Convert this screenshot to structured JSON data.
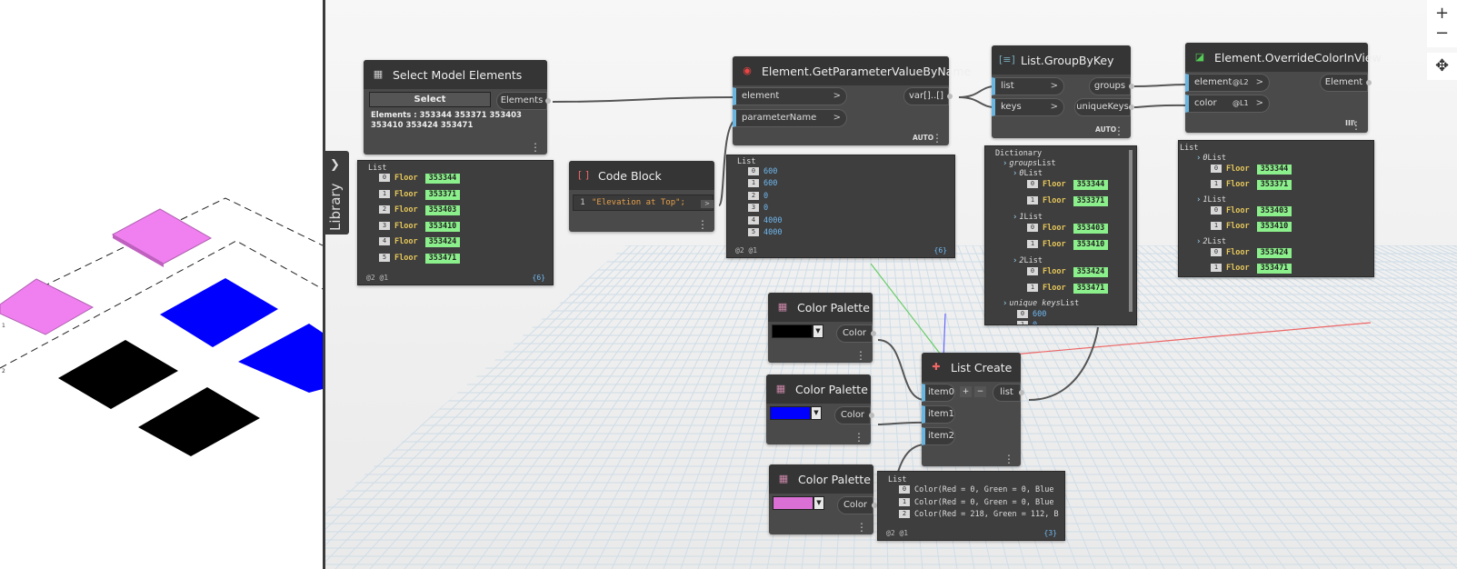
{
  "library": {
    "label": "Library"
  },
  "nodes": {
    "select_model": {
      "title": "Select Model Elements",
      "select_btn": "Select",
      "output": "Elements",
      "info_line1": "Elements : 353344 353371 353403",
      "info_line2": "353410 353424 353471"
    },
    "code_block": {
      "title": "Code Block",
      "line_no": "1",
      "code": "\"Elevation at Top\";"
    },
    "get_param": {
      "title": "Element.GetParameterValueByName",
      "in1": "element",
      "in2": "parameterName",
      "out": "var[]..[]",
      "mode": "AUTO"
    },
    "group_by_key": {
      "title": "List.GroupByKey",
      "in1": "list",
      "in2": "keys",
      "out1": "groups",
      "out2": "uniqueKeys",
      "mode": "AUTO"
    },
    "override": {
      "title": "Element.OverrideColorInView",
      "in1": "element",
      "in1_lace": "@L2",
      "in2": "color",
      "in2_lace": "@L1",
      "out": "Element",
      "lace_icon": "III\\"
    },
    "palette1": {
      "title": "Color Palette",
      "out": "Color",
      "color": "#000000"
    },
    "palette2": {
      "title": "Color Palette",
      "out": "Color",
      "color": "#0000ff"
    },
    "palette3": {
      "title": "Color Palette",
      "out": "Color",
      "color": "#da70d6"
    },
    "list_create": {
      "title": "List Create",
      "in1": "item0",
      "in2": "item1",
      "in3": "item2",
      "out": "list",
      "add": "+",
      "remove": "−"
    }
  },
  "previews": {
    "select_list": {
      "title": "List",
      "rows": [
        {
          "idx": "0",
          "kw": "Floor",
          "val": "353344"
        },
        {
          "idx": "1",
          "kw": "Floor",
          "val": "353371"
        },
        {
          "idx": "2",
          "kw": "Floor",
          "val": "353403"
        },
        {
          "idx": "3",
          "kw": "Floor",
          "val": "353410"
        },
        {
          "idx": "4",
          "kw": "Floor",
          "val": "353424"
        },
        {
          "idx": "5",
          "kw": "Floor",
          "val": "353471"
        }
      ],
      "foot_left": "@2 @1",
      "foot_right": "{6}"
    },
    "param_list": {
      "title": "List",
      "rows": [
        {
          "idx": "0",
          "val": "600"
        },
        {
          "idx": "1",
          "val": "600"
        },
        {
          "idx": "2",
          "val": "0"
        },
        {
          "idx": "3",
          "val": "0"
        },
        {
          "idx": "4",
          "val": "4000"
        },
        {
          "idx": "5",
          "val": "4000"
        }
      ],
      "foot_left": "@2 @1",
      "foot_right": "{6}"
    },
    "dict": {
      "title": "Dictionary",
      "groups_label": "groups",
      "list_word": "List",
      "g0": {
        "idx": "0",
        "rows": [
          {
            "idx": "0",
            "kw": "Floor",
            "val": "353344"
          },
          {
            "idx": "1",
            "kw": "Floor",
            "val": "353371"
          }
        ]
      },
      "g1": {
        "idx": "1",
        "rows": [
          {
            "idx": "0",
            "kw": "Floor",
            "val": "353403"
          },
          {
            "idx": "1",
            "kw": "Floor",
            "val": "353410"
          }
        ]
      },
      "g2": {
        "idx": "2",
        "rows": [
          {
            "idx": "0",
            "kw": "Floor",
            "val": "353424"
          },
          {
            "idx": "1",
            "kw": "Floor",
            "val": "353471"
          }
        ]
      },
      "ukeys_label": "unique keys",
      "ukeys": [
        {
          "idx": "0",
          "val": "600"
        },
        {
          "idx": "1",
          "val": "0"
        }
      ]
    },
    "override_list": {
      "title": "List",
      "groups": [
        {
          "idx": "0",
          "rows": [
            {
              "idx": "0",
              "kw": "Floor",
              "val": "353344"
            },
            {
              "idx": "1",
              "kw": "Floor",
              "val": "353371"
            }
          ]
        },
        {
          "idx": "1",
          "rows": [
            {
              "idx": "0",
              "kw": "Floor",
              "val": "353403"
            },
            {
              "idx": "1",
              "kw": "Floor",
              "val": "353410"
            }
          ]
        },
        {
          "idx": "2",
          "rows": [
            {
              "idx": "0",
              "kw": "Floor",
              "val": "353424"
            },
            {
              "idx": "1",
              "kw": "Floor",
              "val": "353471"
            }
          ]
        }
      ]
    },
    "color_list": {
      "title": "List",
      "rows": [
        {
          "idx": "0",
          "val": "Color(Red = 0, Green = 0, Blue"
        },
        {
          "idx": "1",
          "val": "Color(Red = 0, Green = 0, Blue"
        },
        {
          "idx": "2",
          "val": "Color(Red = 218, Green = 112, B"
        }
      ],
      "foot_left": "@2 @1",
      "foot_right": "{3}"
    }
  },
  "zoom": {
    "plus": "+",
    "minus": "−",
    "fit": "✥"
  }
}
